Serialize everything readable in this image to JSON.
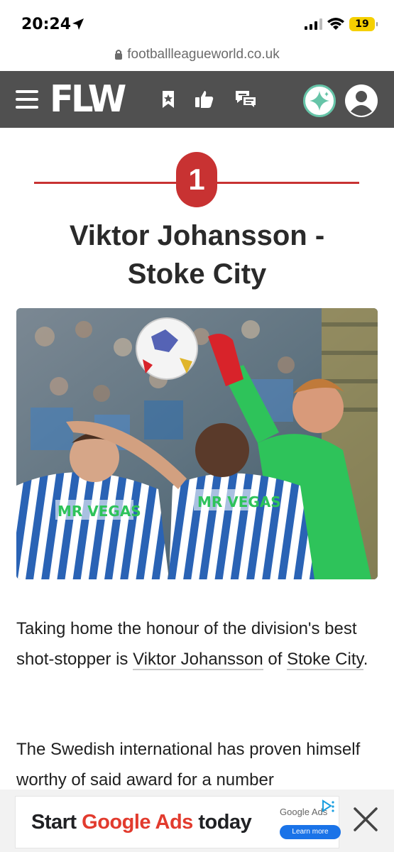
{
  "status_bar": {
    "time": "20:24",
    "battery": "19"
  },
  "url_bar": {
    "domain": "footballleagueworld.co.uk"
  },
  "site_header": {
    "logo": "FLW"
  },
  "ranking": {
    "number": "1"
  },
  "article": {
    "headline_line1": "Viktor Johansson -",
    "headline_line2": "Stoke City",
    "para1_before": "Taking home the honour of the division's best shot-stopper is ",
    "para1_link1": "Viktor Johansson",
    "para1_mid": " of ",
    "para1_link2": "Stoke City",
    "para1_after": ".",
    "para2": "The Swedish international has proven himself worthy of said award for a number"
  },
  "ad": {
    "text_start": "Start ",
    "text_google": "Google Ads",
    "text_end": " today",
    "brand": "Google Ads",
    "button": "Learn more"
  },
  "photo": {
    "shirt_sponsor": "MR VEGAS"
  },
  "colors": {
    "header_bg": "#505050",
    "accent_red": "#c83232",
    "sparkle_ring": "#66c4a8"
  },
  "icons": [
    "location-arrow-icon",
    "signal-icon",
    "wifi-icon",
    "lock-icon",
    "hamburger-menu-icon",
    "bookmark-star-icon",
    "thumbs-up-icon",
    "chat-icon",
    "sparkle-icon",
    "user-icon",
    "adchoices-icon",
    "close-icon"
  ]
}
